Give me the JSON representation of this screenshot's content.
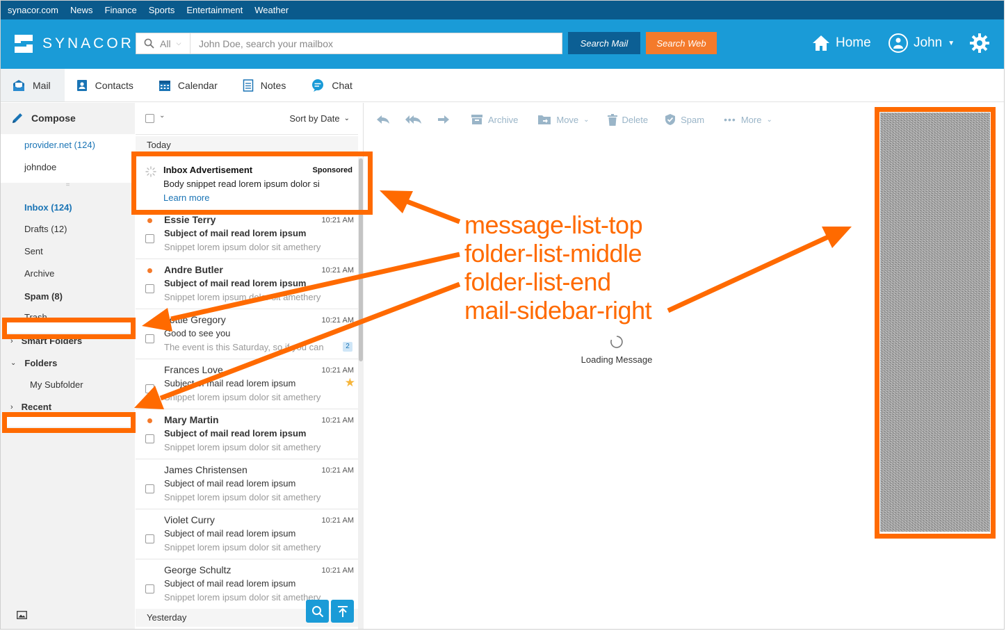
{
  "topbar": {
    "links": [
      "synacor.com",
      "News",
      "Finance",
      "Sports",
      "Entertainment",
      "Weather"
    ]
  },
  "header": {
    "logo_text": "SYNACOR",
    "search_scope": "All",
    "search_placeholder": "John Doe, search your mailbox",
    "search_mail_label": "Search Mail",
    "search_web_label": "Search Web",
    "home_label": "Home",
    "user_label": "John"
  },
  "nav_tabs": [
    {
      "label": "Mail",
      "icon": "mail-icon",
      "active": true
    },
    {
      "label": "Contacts",
      "icon": "contacts-icon"
    },
    {
      "label": "Calendar",
      "icon": "calendar-icon"
    },
    {
      "label": "Notes",
      "icon": "notes-icon"
    },
    {
      "label": "Chat",
      "icon": "chat-icon"
    }
  ],
  "sidebar": {
    "compose_label": "Compose",
    "accounts": [
      "provider.net (124)",
      "johndoe"
    ],
    "folders": [
      "Inbox (124)",
      "Drafts (12)",
      "Sent",
      "Archive",
      "Spam (8)",
      "Trash"
    ],
    "smart_folders": "Smart Folders",
    "folders_section": "Folders",
    "subfolder": "My Subfolder",
    "recent": "Recent"
  },
  "message_list": {
    "sort_label": "Sort by Date",
    "today_label": "Today",
    "yesterday_label": "Yesterday",
    "ad": {
      "title": "Inbox Advertisement",
      "sponsored": "Sponsored",
      "body": "Body snippet read lorem ipsum dolor si",
      "link": "Learn more"
    },
    "rows": [
      {
        "from": "Essie Terry",
        "time": "10:21 AM",
        "subject": "Subject of mail read lorem ipsum",
        "snippet": "Snippet lorem ipsum dolor sit amethery",
        "unread": true
      },
      {
        "from": "Andre Butler",
        "time": "10:21 AM",
        "subject": "Subject of mail read lorem ipsum",
        "snippet": "Snippet lorem ipsum dolor sit amethery",
        "unread": true
      },
      {
        "from": "Lottie Gregory",
        "time": "10:21 AM",
        "subject": "Good to see you",
        "snippet": "The event is this Saturday, so if you can",
        "badge": "2"
      },
      {
        "from": "Frances Love",
        "time": "10:21 AM",
        "subject": "Subject of mail read lorem ipsum",
        "snippet": "Snippet lorem ipsum dolor sit amethery",
        "starred": true
      },
      {
        "from": "Mary Martin",
        "time": "10:21 AM",
        "subject": "Subject of mail read lorem ipsum",
        "snippet": "Snippet lorem ipsum dolor sit amethery",
        "unread": true
      },
      {
        "from": "James Christensen",
        "time": "10:21 AM",
        "subject": "Subject of mail read lorem ipsum",
        "snippet": "Snippet lorem ipsum dolor sit amethery"
      },
      {
        "from": "Violet Curry",
        "time": "10:21 AM",
        "subject": "Subject of mail read lorem ipsum",
        "snippet": "Snippet lorem ipsum dolor sit amethery"
      },
      {
        "from": "George Schultz",
        "time": "10:21 AM",
        "subject": "Subject of mail read lorem ipsum",
        "snippet": "Snippet lorem ipsum dolor sit amethery"
      }
    ]
  },
  "toolbar": {
    "archive": "Archive",
    "move": "Move",
    "delete": "Delete",
    "spam": "Spam",
    "more": "More"
  },
  "reading_pane": {
    "loading": "Loading Message"
  },
  "annotations": {
    "labels": [
      "message-list-top",
      "folder-list-middle",
      "folder-list-end",
      "mail-sidebar-right"
    ],
    "color": "#ff6a00"
  },
  "colors": {
    "header": "#1a9bd7",
    "topbar": "#0a5a8c",
    "search_mail": "#0c5f94",
    "search_web": "#f47a2b",
    "link": "#1a74b5"
  }
}
